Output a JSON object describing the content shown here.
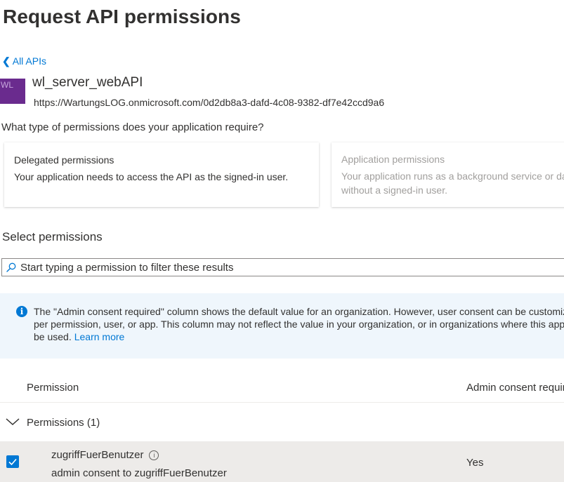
{
  "page": {
    "title": "Request API permissions"
  },
  "nav": {
    "back_label": "All APIs"
  },
  "api": {
    "logo_text": "WL",
    "name": "wl_server_webAPI",
    "url": "https://WartungsLOG.onmicrosoft.com/0d2db8a3-dafd-4c08-9382-df7e42ccd9a6"
  },
  "permission_type": {
    "question": "What type of permissions does your application require?",
    "delegated": {
      "title": "Delegated permissions",
      "description": "Your application needs to access the API as the signed-in user."
    },
    "application": {
      "title": "Application permissions",
      "description_line1": "Your application runs as a background service or daemon",
      "description_line2": "without a signed-in user."
    }
  },
  "select": {
    "heading": "Select permissions",
    "search_placeholder": "Start typing a permission to filter these results"
  },
  "info_banner": {
    "line1": "The \"Admin consent required\" column shows the default value for an organization. However, user consent can be customized",
    "line2": "per permission, user, or app. This column may not reflect the value in your organization, or in organizations where this app will",
    "line3": "be used.",
    "link": "Learn more"
  },
  "table": {
    "columns": {
      "permission": "Permission",
      "admin_consent": "Admin consent required"
    },
    "group": {
      "label": "Permissions (1)"
    },
    "rows": [
      {
        "name": "zugriffFuerBenutzer",
        "description": "admin consent to zugriffFuerBenutzer",
        "admin_consent": "Yes",
        "checked": true
      }
    ]
  },
  "colors": {
    "accent": "#0078d4",
    "text": "#323130",
    "disabled_text": "#a19f9d",
    "info_background": "#eff6fc",
    "row_selected": "#edebe9",
    "logo_background": "#6a2b8e"
  },
  "icons": {
    "back": "chevron-left-icon",
    "search": "search-icon",
    "info": "info-icon",
    "group_toggle": "chevron-down-icon",
    "checkbox": "checkmark-icon",
    "permission_info": "info-circle-icon"
  }
}
